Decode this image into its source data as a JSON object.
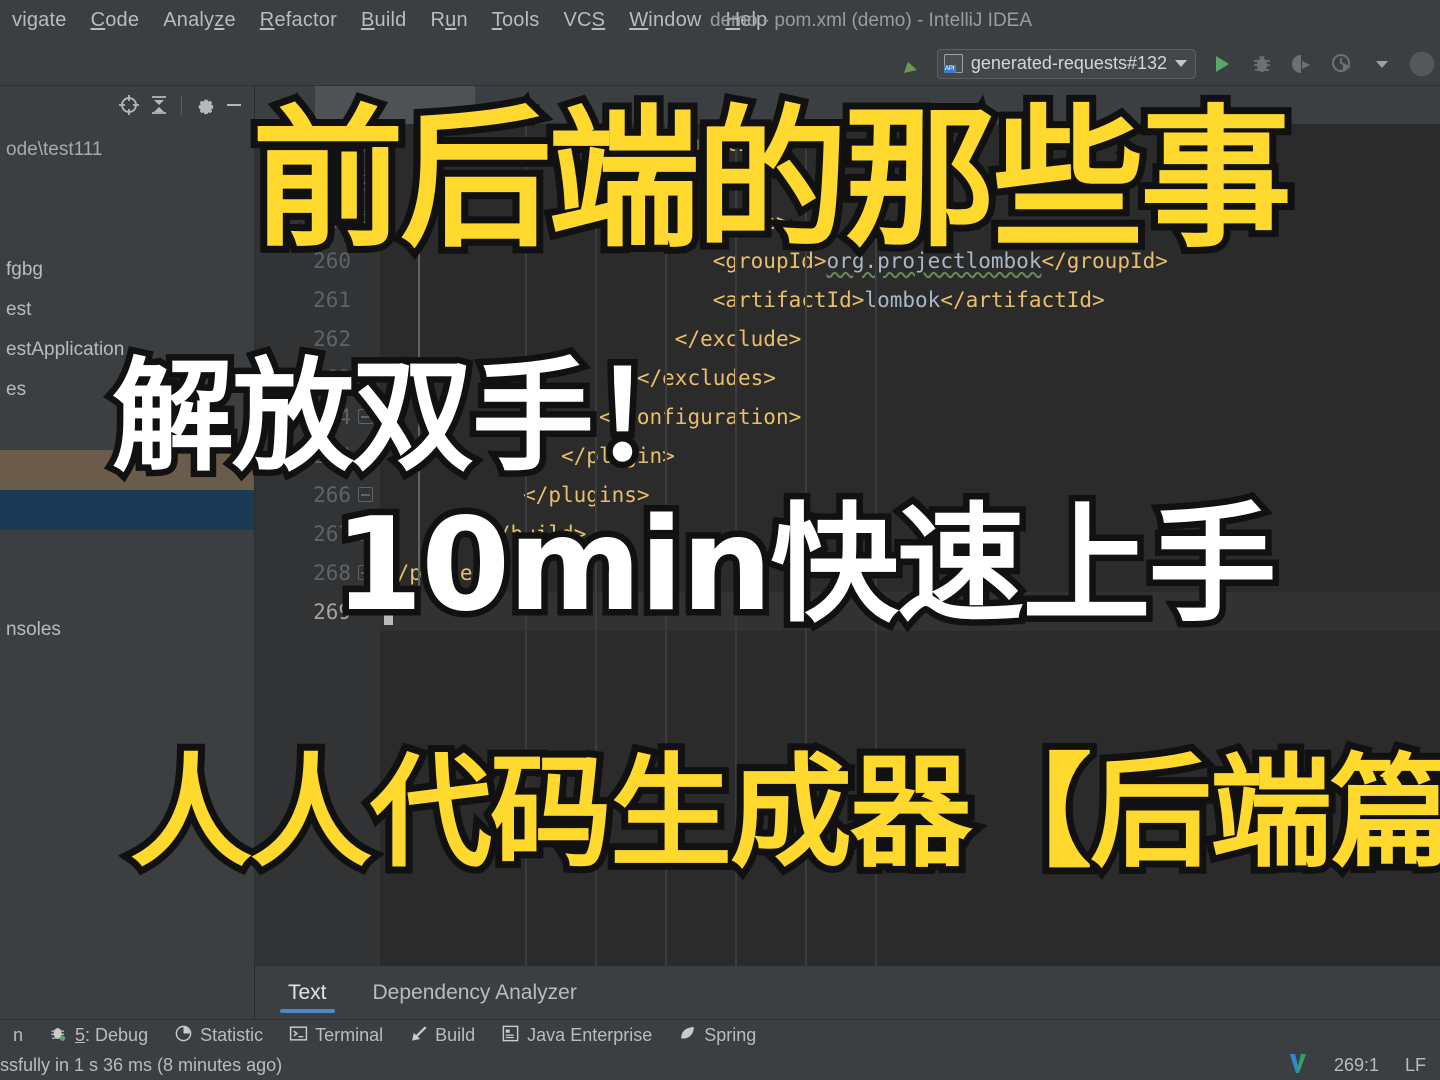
{
  "window": {
    "title": "demo - pom.xml (demo) - IntelliJ IDEA"
  },
  "menubar": {
    "items": [
      {
        "label": "vigate",
        "accel": ""
      },
      {
        "label": "Code",
        "accel": "C"
      },
      {
        "label": "Analyze",
        "accel": "z"
      },
      {
        "label": "Refactor",
        "accel": "R"
      },
      {
        "label": "Build",
        "accel": "B"
      },
      {
        "label": "Run",
        "accel": "u"
      },
      {
        "label": "Tools",
        "accel": "T"
      },
      {
        "label": "VCS",
        "accel": "S"
      },
      {
        "label": "Window",
        "accel": "W"
      },
      {
        "label": "Help",
        "accel": "H"
      }
    ]
  },
  "toolbar": {
    "back_icon": "back-arrow-icon",
    "run_config": "generated-requests#132",
    "run_icon": "run-icon",
    "debug_icon": "debug-icon",
    "run_coverage_icon": "run-with-coverage-icon",
    "profiler_icon": "profiler-icon",
    "more_icon": "chevron-down-icon",
    "avatar_icon": "user-avatar-icon"
  },
  "sidebar": {
    "tools": [
      "locate-icon",
      "collapse-all-icon",
      "settings-icon",
      "minimize-icon"
    ],
    "tree": [
      {
        "label": "ode\\test111",
        "state": "path"
      },
      {
        "label": "",
        "state": "blank"
      },
      {
        "label": "",
        "state": "blank"
      },
      {
        "label": "fgbg",
        "state": "normal"
      },
      {
        "label": "est",
        "state": "normal"
      },
      {
        "label": "estApplication",
        "state": "normal"
      },
      {
        "label": "es",
        "state": "normal"
      },
      {
        "label": "",
        "state": "blank"
      },
      {
        "label": "",
        "state": "tan"
      },
      {
        "label": "",
        "state": "selected"
      },
      {
        "label": "",
        "state": "blank"
      },
      {
        "label": "",
        "state": "blank"
      },
      {
        "label": "nsoles",
        "state": "normal"
      }
    ]
  },
  "editor": {
    "lines": [
      {
        "num": "257",
        "fold": true,
        "indent": 17,
        "parts": [
          {
            "t": "tag",
            "v": "<configuration>"
          }
        ]
      },
      {
        "num": "258",
        "fold": true,
        "indent": 20,
        "parts": [
          {
            "t": "tag",
            "v": "<excludes>"
          }
        ]
      },
      {
        "num": "259",
        "fold": true,
        "indent": 23,
        "parts": [
          {
            "t": "tag",
            "v": "<exclude>"
          }
        ]
      },
      {
        "num": "260",
        "fold": false,
        "indent": 26,
        "parts": [
          {
            "t": "tag",
            "v": "<groupId>"
          },
          {
            "t": "wavy",
            "v": "org.projectlombok"
          },
          {
            "t": "tag",
            "v": "</groupId>"
          }
        ]
      },
      {
        "num": "261",
        "fold": false,
        "indent": 26,
        "parts": [
          {
            "t": "tag",
            "v": "<artifactId>"
          },
          {
            "t": "txt",
            "v": "lombok"
          },
          {
            "t": "tag",
            "v": "</artifactId>"
          }
        ]
      },
      {
        "num": "262",
        "fold": false,
        "indent": 23,
        "parts": [
          {
            "t": "tag",
            "v": "</exclude>"
          }
        ]
      },
      {
        "num": "263",
        "fold": true,
        "indent": 20,
        "parts": [
          {
            "t": "tag",
            "v": "</excludes>"
          }
        ]
      },
      {
        "num": "264",
        "fold": true,
        "indent": 17,
        "parts": [
          {
            "t": "tag",
            "v": "</configuration>"
          }
        ]
      },
      {
        "num": "265",
        "fold": true,
        "indent": 14,
        "parts": [
          {
            "t": "tag",
            "v": "</plugin>"
          }
        ]
      },
      {
        "num": "266",
        "fold": true,
        "indent": 11,
        "parts": [
          {
            "t": "tag",
            "v": "</plugins>"
          }
        ]
      },
      {
        "num": "267",
        "fold": true,
        "indent": 8,
        "parts": [
          {
            "t": "tag",
            "v": "</build>"
          }
        ]
      },
      {
        "num": "268",
        "fold": true,
        "indent": 0,
        "parts": [
          {
            "t": "tag",
            "v": "</project>"
          }
        ]
      },
      {
        "num": "269",
        "fold": false,
        "indent": 0,
        "parts": [],
        "current": true
      }
    ]
  },
  "bottom_tabs": [
    {
      "label": "Text",
      "active": true
    },
    {
      "label": "Dependency Analyzer",
      "active": false
    }
  ],
  "toolwindows": [
    {
      "icon": "",
      "label": "n",
      "accel": ""
    },
    {
      "icon": "debug-icon",
      "label": "5: Debug",
      "accel": "5"
    },
    {
      "icon": "statistic-icon",
      "label": "Statistic",
      "accel": ""
    },
    {
      "icon": "terminal-icon",
      "label": "Terminal",
      "accel": ""
    },
    {
      "icon": "build-icon",
      "label": "Build",
      "accel": ""
    },
    {
      "icon": "java-enterprise-icon",
      "label": "Java Enterprise",
      "accel": ""
    },
    {
      "icon": "spring-icon",
      "label": "Spring",
      "accel": ""
    }
  ],
  "statusbar": {
    "message": "ssfully in 1 s 36 ms (8 minutes ago)",
    "vcs_icon": "vim-icon",
    "caret_position": "269:1",
    "line_separator": "LF"
  },
  "overlays": {
    "title_top": "前后端的那些事",
    "title_mid1": "解放双手！",
    "title_mid2": "10min快速上手",
    "title_bottom": "人人代码生成器【后端篇】"
  },
  "colors": {
    "overlay_yellow": "#ffd92e",
    "overlay_white": "#ffffff",
    "overlay_stroke": "#111111",
    "editor_bg": "#2b2b2b",
    "ide_bg": "#3c3f41",
    "tab_accent": "#4a88c7",
    "xml_tag": "#e8bf6a",
    "xml_text": "#a9b7c6",
    "selected_row": "#1b3a56"
  }
}
